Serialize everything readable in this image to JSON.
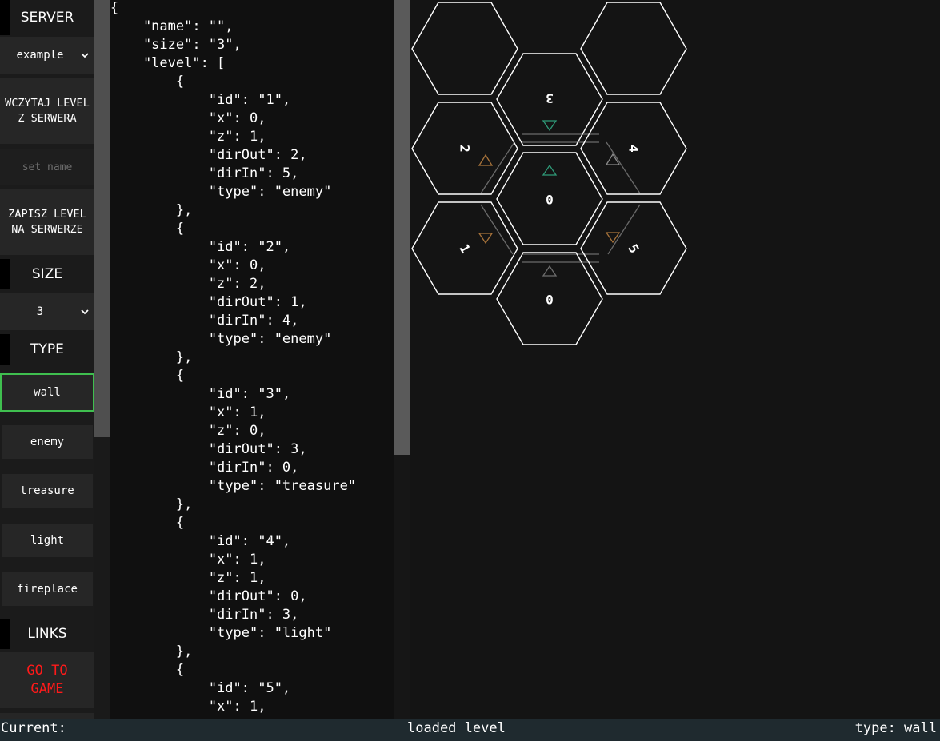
{
  "sidebar": {
    "server_heading": "SERVER",
    "server_select": "example",
    "load_button": "WCZYTAJ LEVEL Z SERWERA",
    "name_placeholder": "set name",
    "save_button": "ZAPISZ LEVEL NA SERWERZE",
    "size_heading": "SIZE",
    "size_select": "3",
    "type_heading": "TYPE",
    "types": [
      "wall",
      "enemy",
      "treasure",
      "light",
      "fireplace"
    ],
    "active_type": "wall",
    "links_heading": "LINKS",
    "goto_button": "GO TO GAME"
  },
  "editor": {
    "json_text": "{\n    \"name\": \"\",\n    \"size\": \"3\",\n    \"level\": [\n        {\n            \"id\": \"1\",\n            \"x\": 0,\n            \"z\": 1,\n            \"dirOut\": 2,\n            \"dirIn\": 5,\n            \"type\": \"enemy\"\n        },\n        {\n            \"id\": \"2\",\n            \"x\": 0,\n            \"z\": 2,\n            \"dirOut\": 1,\n            \"dirIn\": 4,\n            \"type\": \"enemy\"\n        },\n        {\n            \"id\": \"3\",\n            \"x\": 1,\n            \"z\": 0,\n            \"dirOut\": 3,\n            \"dirIn\": 0,\n            \"type\": \"treasure\"\n        },\n        {\n            \"id\": \"4\",\n            \"x\": 1,\n            \"z\": 1,\n            \"dirOut\": 0,\n            \"dirIn\": 3,\n            \"type\": \"light\"\n        },\n        {\n            \"id\": \"5\",\n            \"x\": 1,\n            \"z\": \""
  },
  "board": {
    "hexes": [
      {
        "label": "",
        "rotation": 0
      },
      {
        "label": "",
        "rotation": 0
      },
      {
        "label": "3",
        "rotation": 180
      },
      {
        "label": "2",
        "rotation": 90
      },
      {
        "label": "4",
        "rotation": 90
      },
      {
        "label": "0",
        "rotation": 0
      },
      {
        "label": "1",
        "rotation": 60
      },
      {
        "label": "5",
        "rotation": 60
      },
      {
        "label": "0",
        "rotation": 0
      }
    ],
    "colors": {
      "stroke": "#ffffff",
      "green_arrow": "#2e9a78",
      "orange_arrow": "#a8733a",
      "gray_arrow": "#8a8a8a"
    }
  },
  "status": {
    "current": "Current:",
    "message": "loaded level",
    "type": "type: wall"
  },
  "colors": {
    "active_border": "#3fbf4f",
    "goto_text": "#ff1a1a",
    "status_bg": "#1f2a2f"
  }
}
